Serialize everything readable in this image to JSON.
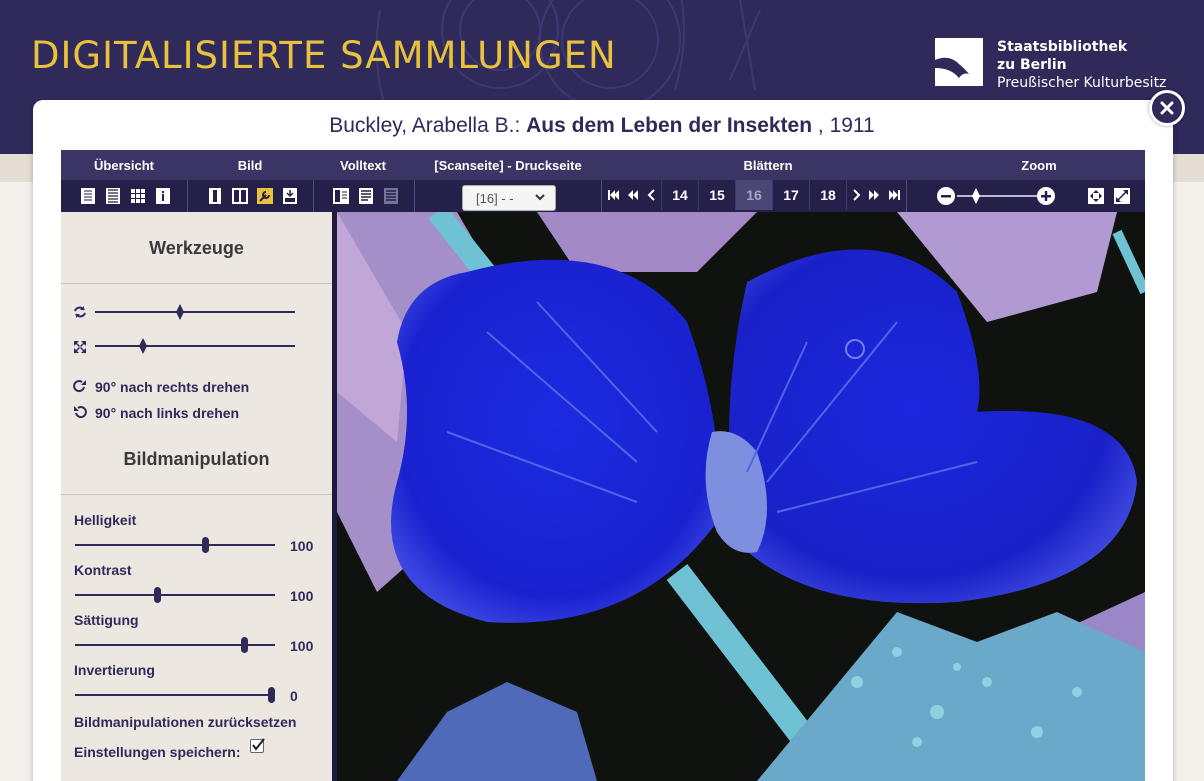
{
  "header": {
    "site_title": "DIGITALISIERTE SAMMLUNGEN",
    "logo_line1": "Staatsbibliothek",
    "logo_line2": "zu Berlin",
    "logo_line3": "Preußischer Kulturbesitz"
  },
  "book": {
    "author": "Buckley, Arabella B.:",
    "title": "Aus dem Leben der Insekten",
    "year": ", 1911"
  },
  "toolbar": {
    "group_labels": {
      "overview": "Übersicht",
      "image": "Bild",
      "fulltext": "Volltext",
      "page": "[Scanseite] - Druckseite",
      "browse": "Blättern",
      "zoom": "Zoom"
    },
    "page_select_value": "[16] - -",
    "pages": [
      "14",
      "15",
      "16",
      "17",
      "18"
    ],
    "current_page": "16"
  },
  "tools": {
    "heading": "Werkzeuge",
    "rotate_right": "90° nach rechts drehen",
    "rotate_left": "90° nach links drehen"
  },
  "manipulation": {
    "heading": "Bildmanipulation",
    "brightness_label": "Helligkeit",
    "brightness_value": "100",
    "contrast_label": "Kontrast",
    "contrast_value": "100",
    "saturation_label": "Sättigung",
    "saturation_value": "100",
    "invert_label": "Invertierung",
    "invert_value": "0",
    "reset_label": "Bildmanipulationen zurücksetzen",
    "save_label": "Einstellungen speichern:",
    "save_checked": true
  },
  "colors": {
    "brand_navy": "#2f2a5a",
    "title_gold": "#e8c23c",
    "active_tool": "#e8c23c"
  }
}
